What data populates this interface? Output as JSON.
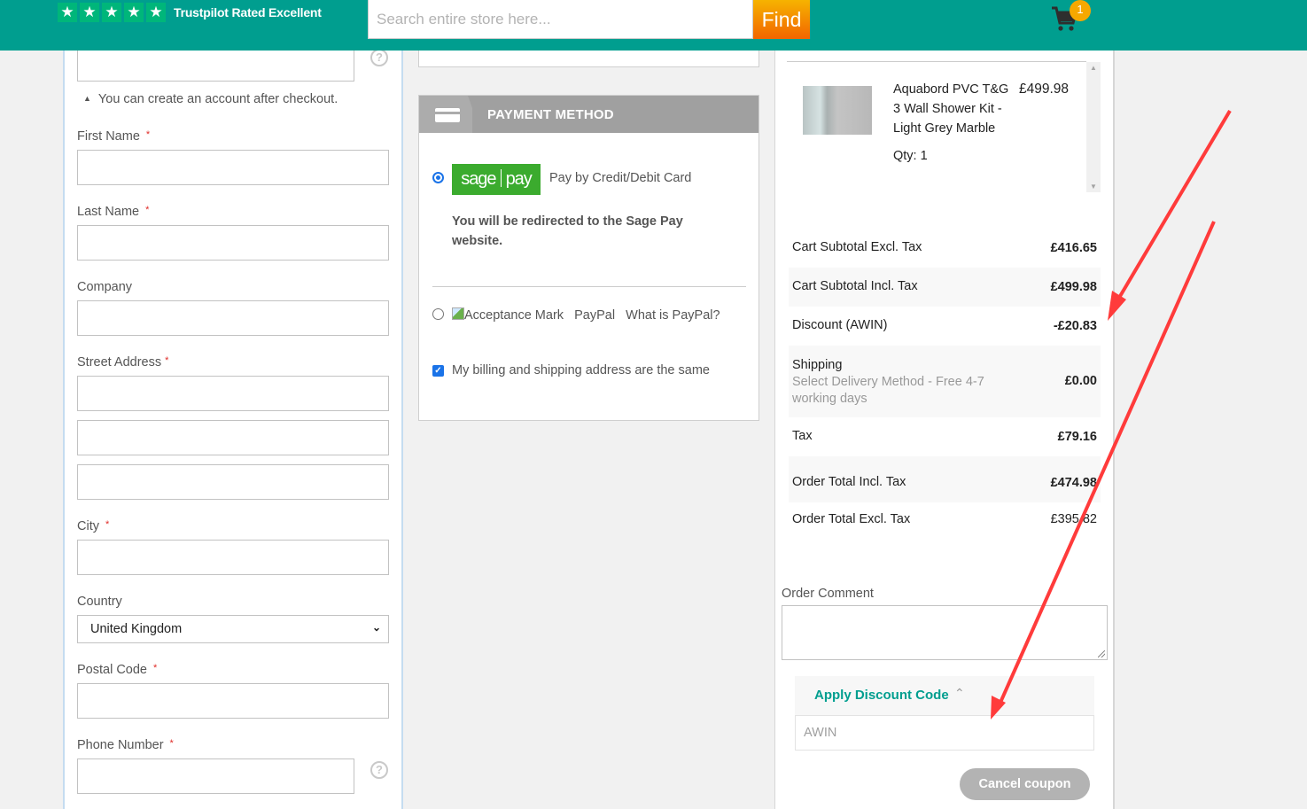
{
  "header": {
    "trustpilot_text": "Trustpilot Rated Excellent",
    "rating_stars": 5,
    "search_placeholder": "Search entire store here...",
    "find_label": "Find",
    "cart_count": "1",
    "brand_color": "#009e8f"
  },
  "shipping_form": {
    "account_note": "You can create an account after checkout.",
    "first_name_label": "First Name",
    "last_name_label": "Last Name",
    "company_label": "Company",
    "street_label": "Street Address",
    "city_label": "City",
    "country_label": "Country",
    "country_value": "United Kingdom",
    "postal_label": "Postal Code",
    "phone_label": "Phone Number",
    "required_mark": "*",
    "help_glyph": "?"
  },
  "payment": {
    "title": "PAYMENT METHOD",
    "sagepay_logo_left": "sage",
    "sagepay_logo_right": "pay",
    "sagepay_label": "Pay by Credit/Debit Card",
    "sagepay_selected": true,
    "redirect_note": "You will be redirected to the Sage Pay website.",
    "paypal_img_alt": "Acceptance Mark",
    "paypal_label": "PayPal",
    "paypal_link": "What is PayPal?",
    "billing_same_label": "My billing and shipping address are the same",
    "billing_same_checked": true
  },
  "summary": {
    "item": {
      "name": "Aquabord PVC T&G 3 Wall Shower Kit - Light Grey Marble",
      "price": "£499.98",
      "qty": "Qty: 1"
    },
    "totals": [
      {
        "label": "Cart Subtotal Excl. Tax",
        "value": "£416.65"
      },
      {
        "label": "Cart Subtotal Incl. Tax",
        "value": "£499.98"
      },
      {
        "label": "Discount (AWIN)",
        "value": "-£20.83"
      },
      {
        "label": "Shipping",
        "sub": "Select Delivery Method - Free 4-7 working days",
        "value": "£0.00"
      },
      {
        "label": "Tax",
        "value": "£79.16"
      },
      {
        "label": "Order Total Incl. Tax",
        "value": "£474.98"
      },
      {
        "label": "Order Total Excl. Tax",
        "value": "£395.82"
      }
    ],
    "comment_label": "Order Comment",
    "discount_title": "Apply Discount Code",
    "discount_code": "AWIN",
    "cancel_coupon_label": "Cancel coupon"
  },
  "annotation_color": "#ff3b3b"
}
